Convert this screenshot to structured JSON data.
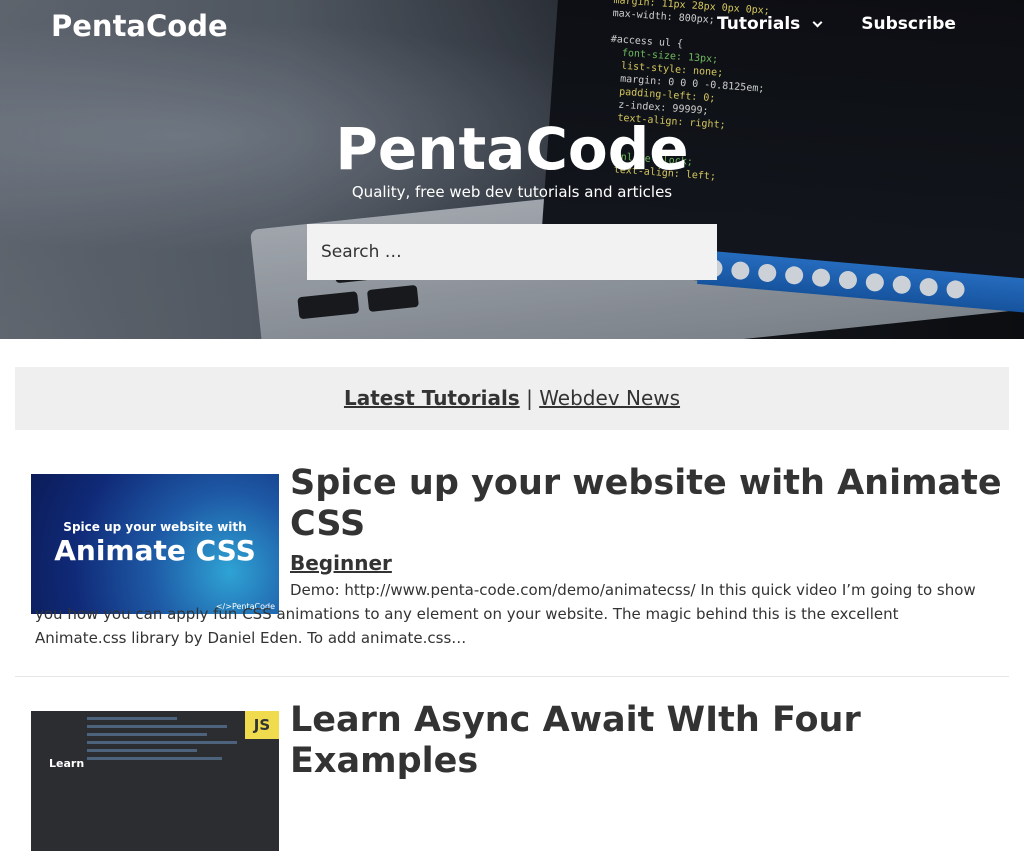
{
  "site": {
    "title": "PentaCode"
  },
  "nav": {
    "items": [
      {
        "label": "Tutorials",
        "has_submenu": true
      },
      {
        "label": "Subscribe"
      }
    ]
  },
  "hero": {
    "title": "PentaCode",
    "tagline": "Quality, free web dev tutorials and articles",
    "search_placeholder": "Search …"
  },
  "tabs": {
    "active": "Latest Tutorials",
    "separator": "|",
    "other": "Webdev News"
  },
  "articles": [
    {
      "title": "Spice up your website with Animate CSS",
      "level": "Beginner",
      "excerpt": "Demo:  http://www.penta-code.com/demo/animatecss/ In this quick video I’m going to show you how you can apply fun CSS animations to any element on your website.  The magic behind this is the excellent Animate.css library by Daniel Eden. To add animate.css…",
      "thumb": {
        "line1": "Spice up your website with",
        "line2": "Animate CSS",
        "credit": "</>PentaCode"
      }
    },
    {
      "title": "Learn Async Await WIth Four Examples",
      "thumb": {
        "badge": "JS",
        "caption": "Learn"
      }
    }
  ],
  "hero_code": {
    "lines": [
      "margin: 11px 28px 0px 0px;",
      "max-width: 800px;",
      "",
      "#access ul {",
      "  font-size: 13px;",
      "  list-style: none;",
      "  margin: 0 0 0 -0.8125em;",
      "  padding-left: 0;",
      "  z-index: 99999;",
      "  text-align: right;",
      "",
      "",
      "  inline-block;",
      "  text-align: left;"
    ]
  },
  "colors": {
    "accent": "#333333",
    "white": "#ffffff",
    "tabs_bg": "#efefef",
    "search_bg": "#f2f2f2"
  }
}
